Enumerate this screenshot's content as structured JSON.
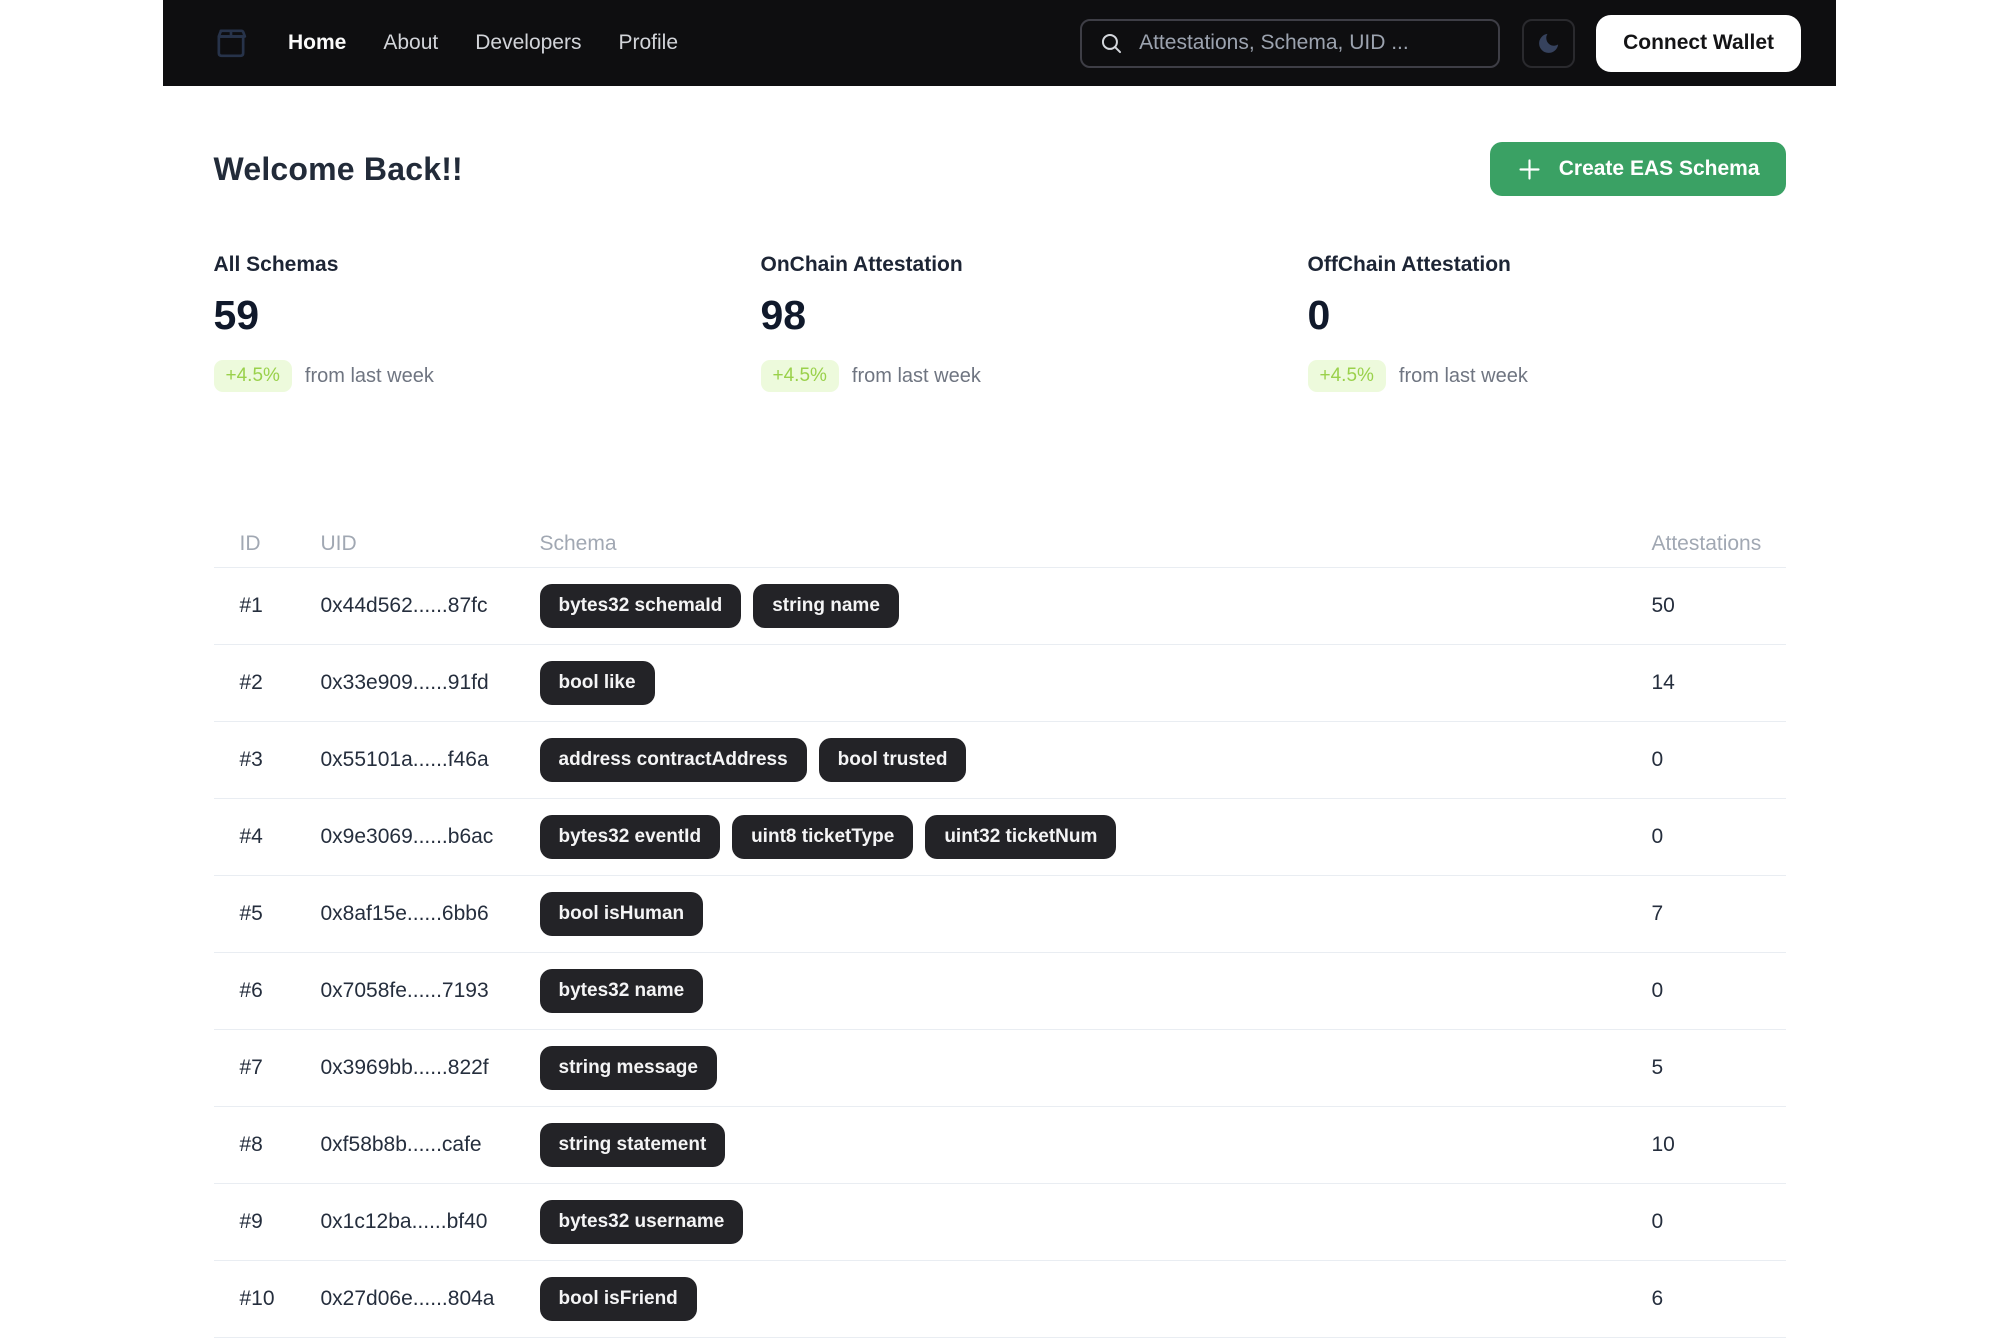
{
  "navbar": {
    "logo_icon": "package-icon",
    "links": [
      {
        "label": "Home"
      },
      {
        "label": "About"
      },
      {
        "label": "Developers"
      },
      {
        "label": "Profile"
      }
    ],
    "search": {
      "icon": "search-icon",
      "placeholder": "Attestations, Schema, UID ..."
    },
    "theme_toggle_icon": "moon-icon",
    "wallet_button_label": "Connect Wallet"
  },
  "page": {
    "title": "Welcome Back!!",
    "create_button_label": "Create EAS Schema",
    "create_button_icon": "plus-icon"
  },
  "stats": [
    {
      "label": "All Schemas",
      "value": "59",
      "change": "+4.5%",
      "change_note": "from last week"
    },
    {
      "label": "OnChain Attestation",
      "value": "98",
      "change": "+4.5%",
      "change_note": "from last week"
    },
    {
      "label": "OffChain Attestation",
      "value": "0",
      "change": "+4.5%",
      "change_note": "from last week"
    }
  ],
  "table": {
    "columns": [
      "ID",
      "UID",
      "Schema",
      "Attestations"
    ],
    "rows": [
      {
        "id": "#1",
        "uid": "0x44d562......87fc",
        "schema": [
          "bytes32 schemaId",
          "string name"
        ],
        "attestations": "50"
      },
      {
        "id": "#2",
        "uid": "0x33e909......91fd",
        "schema": [
          "bool like"
        ],
        "attestations": "14"
      },
      {
        "id": "#3",
        "uid": "0x55101a......f46a",
        "schema": [
          "address contractAddress",
          "bool trusted"
        ],
        "attestations": "0"
      },
      {
        "id": "#4",
        "uid": "0x9e3069......b6ac",
        "schema": [
          "bytes32 eventId",
          "uint8 ticketType",
          "uint32 ticketNum"
        ],
        "attestations": "0"
      },
      {
        "id": "#5",
        "uid": "0x8af15e......6bb6",
        "schema": [
          "bool isHuman"
        ],
        "attestations": "7"
      },
      {
        "id": "#6",
        "uid": "0x7058fe......7193",
        "schema": [
          "bytes32 name"
        ],
        "attestations": "0"
      },
      {
        "id": "#7",
        "uid": "0x3969bb......822f",
        "schema": [
          "string message"
        ],
        "attestations": "5"
      },
      {
        "id": "#8",
        "uid": "0xf58b8b......cafe",
        "schema": [
          "string statement"
        ],
        "attestations": "10"
      },
      {
        "id": "#9",
        "uid": "0x1c12ba......bf40",
        "schema": [
          "bytes32 username"
        ],
        "attestations": "0"
      },
      {
        "id": "#10",
        "uid": "0x27d06e......804a",
        "schema": [
          "bool isFriend"
        ],
        "attestations": "6"
      }
    ]
  },
  "colors": {
    "navbar-bg": "#0e0e10",
    "accent-green": "#3aa164",
    "badge-bg": "#edfadc",
    "badge-text": "#9ad14b",
    "pill-bg": "#232327"
  }
}
